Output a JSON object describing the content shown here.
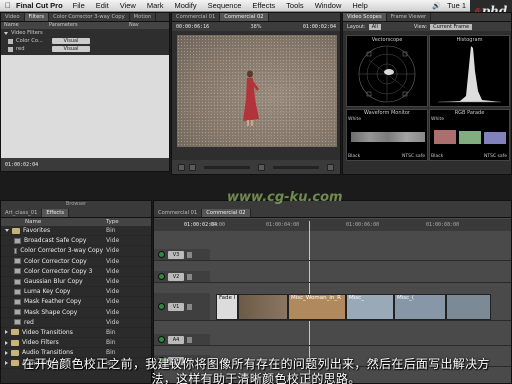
{
  "menubar": {
    "app_name": "Final Cut Pro",
    "items": [
      "File",
      "Edit",
      "View",
      "Mark",
      "Modify",
      "Sequence",
      "Effects",
      "Tools",
      "Window",
      "Help"
    ],
    "clock": "Tue 1"
  },
  "logo": {
    "text": "phd",
    "prefix": "@"
  },
  "filters_window": {
    "tabs": [
      "Video",
      "Filters",
      "Color Corrector 3-way Copy",
      "Motion"
    ],
    "columns": [
      "Name",
      "Parameters",
      "Nav"
    ],
    "rows": [
      {
        "name": "Video Filters",
        "value": ""
      },
      {
        "name": "Color Co...",
        "value": "Visual"
      },
      {
        "name": "red",
        "value": "Visual"
      }
    ]
  },
  "viewer": {
    "tabs": [
      "Commercial 01",
      "Commercial 02"
    ],
    "timecode_left": "00:00:06:16",
    "zoom": "38%",
    "timecode_right": "01:00:02:04",
    "bottom_timecode": "01:00:02:04"
  },
  "scopes": {
    "tabs": [
      "Video Scopes",
      "Frame Viewer"
    ],
    "layout_label": "Layout:",
    "layout_value": "All",
    "view_label": "View:",
    "view_value": "Current Frame",
    "vectorscope_label": "Vectorscope",
    "histogram_label": "Histogram",
    "waveform_label": "Waveform Monitor",
    "parade_label": "RGB Parade",
    "ntsc_label": "NTSC safe",
    "white_label": "White",
    "black_label": "Black"
  },
  "browser": {
    "title": "Browser",
    "tabs": [
      "Art_class_01",
      "Effects"
    ],
    "columns": [
      "Name",
      "Type"
    ],
    "rows": [
      {
        "name": "Favorites",
        "type": "Bin",
        "kind": "folder",
        "indent": 0
      },
      {
        "name": "Broadcast Safe Copy",
        "type": "Vide",
        "kind": "effect",
        "indent": 1
      },
      {
        "name": "Color Corrector 3-way Copy",
        "type": "Vide",
        "kind": "effect",
        "indent": 1
      },
      {
        "name": "Color Corrector Copy",
        "type": "Vide",
        "kind": "effect",
        "indent": 1
      },
      {
        "name": "Color Corrector Copy 3",
        "type": "Vide",
        "kind": "effect",
        "indent": 1
      },
      {
        "name": "Gaussian Blur Copy",
        "type": "Vide",
        "kind": "effect",
        "indent": 1
      },
      {
        "name": "Luma Key Copy",
        "type": "Vide",
        "kind": "effect",
        "indent": 1
      },
      {
        "name": "Mask Feather Copy",
        "type": "Vide",
        "kind": "effect",
        "indent": 1
      },
      {
        "name": "Mask Shape Copy",
        "type": "Vide",
        "kind": "effect",
        "indent": 1
      },
      {
        "name": "red",
        "type": "Vide",
        "kind": "effect",
        "indent": 1
      },
      {
        "name": "Video Transitions",
        "type": "Bin",
        "kind": "folder",
        "indent": 0
      },
      {
        "name": "Video Filters",
        "type": "Bin",
        "kind": "folder",
        "indent": 0
      },
      {
        "name": "Audio Transitions",
        "type": "Bin",
        "kind": "folder",
        "indent": 0
      },
      {
        "name": "Audio Filters",
        "type": "Bin",
        "kind": "folder",
        "indent": 0
      }
    ]
  },
  "timeline": {
    "tabs": [
      "Commercial 01",
      "Commercial 02"
    ],
    "timecode": "01:00:02:04",
    "ruler_marks": [
      "00:00",
      "01:00:04:00",
      "01:00:06:00",
      "01:00:08:00"
    ],
    "tracks": [
      "V3",
      "V2",
      "V1",
      "A4",
      "A5"
    ],
    "v1_clips": [
      "Fade I",
      "Misc_Woman_in_R",
      "Misc_",
      "Misc_("
    ]
  },
  "watermark": "www.cg-ku.com",
  "subtitle": {
    "line1": "在开始颜色校正之前，我建议你将图像所有存在的问题列出来，然后在后面写出解决方",
    "line2": "法，这样有助于清晰颜色校正的思路。"
  }
}
